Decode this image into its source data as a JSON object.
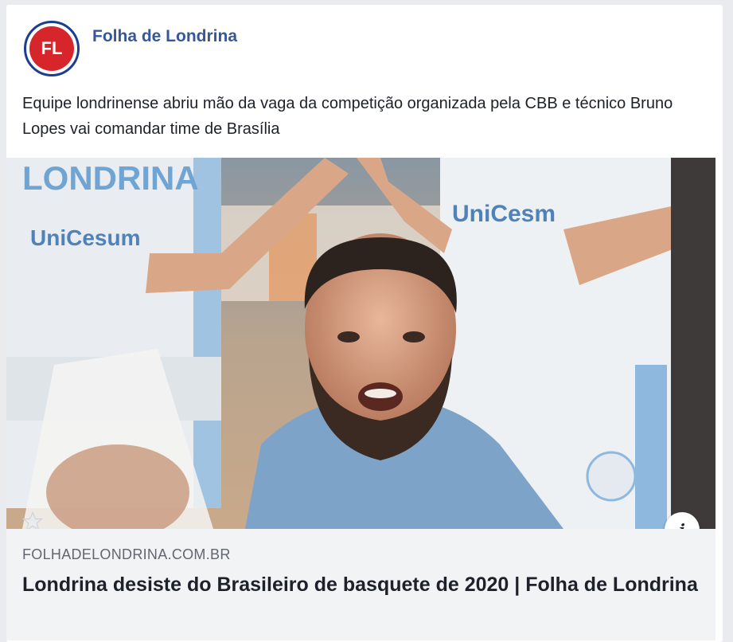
{
  "post": {
    "page_name": "Folha de Londrina",
    "avatar_initials": "FL",
    "text": "Equipe londrinense abriu mão da vaga da competição organizada pela CBB e técnico Bruno Lopes vai comandar time de Brasília"
  },
  "link_preview": {
    "domain": "FOLHADELONDRINA.COM.BR",
    "title": "Londrina desiste do Brasileiro de basquete de 2020 | Folha de Londrina",
    "jersey_text_left": "UniCesum",
    "jersey_text_right": "UniCesm",
    "jersey_top_text": "LONDRINA",
    "info_icon": "info-icon",
    "favorite_icon": "star-icon"
  },
  "colors": {
    "page_name": "#365899",
    "avatar_red": "#d6262c",
    "avatar_ring": "#1d3d8f",
    "meta_bg": "#f2f3f5",
    "domain_text": "#606770"
  }
}
